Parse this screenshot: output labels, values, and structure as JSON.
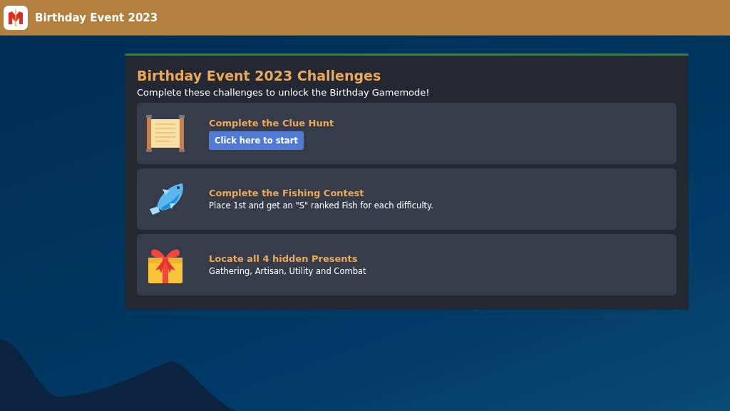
{
  "header": {
    "title": "Birthday Event 2023"
  },
  "panel": {
    "title": "Birthday Event 2023 Challenges",
    "subtitle": "Complete these challenges to unlock the Birthday Gamemode!",
    "challenges": [
      {
        "title": "Complete the Clue Hunt",
        "kind": "button",
        "detail": "Click here to start"
      },
      {
        "title": "Complete the Fishing Contest",
        "kind": "text",
        "detail": "Place 1st and get an \"S\" ranked Fish for each difficulty."
      },
      {
        "title": "Locate all 4 hidden Presents",
        "kind": "text",
        "detail": "Gathering, Artisan, Utility and Combat"
      }
    ]
  }
}
